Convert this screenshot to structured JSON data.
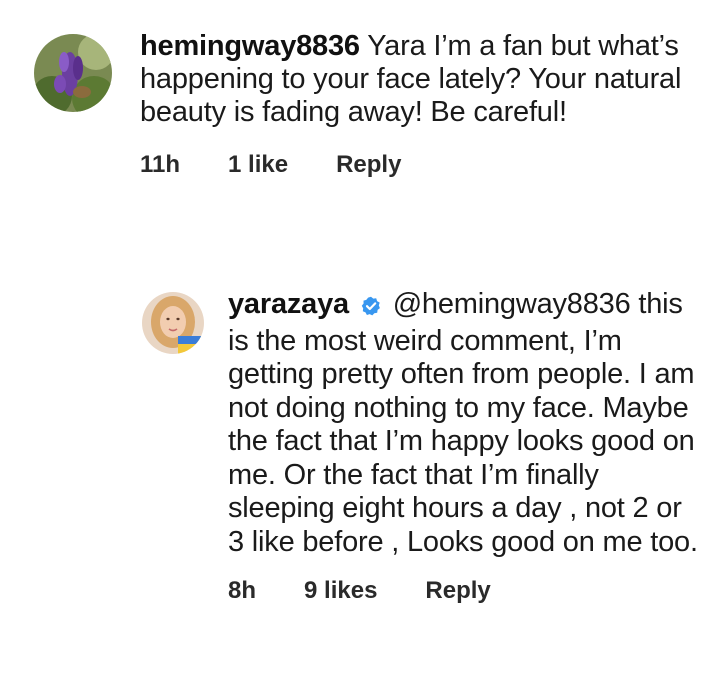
{
  "comments": [
    {
      "username": "hemingway8836",
      "text": "Yara I’m a fan but what’s happening to your face lately? Your natural beauty is fading away! Be careful!",
      "time": "11h",
      "likes": "1 like",
      "reply_label": "Reply",
      "avatar_icon": "profile-photo-purple-flowers"
    },
    {
      "username": "yarazaya",
      "verified": true,
      "mention": "@hemingway8836",
      "text": "this is the most weird comment, I’m getting pretty often from people. I am not doing nothing to my face. Maybe the fact that I’m happy looks good on me. Or the fact that I’m  finally sleeping eight hours a day , not 2 or 3 like before , Looks good on me too.",
      "time": "8h",
      "likes": "9 likes",
      "reply_label": "Reply",
      "avatar_icon": "profile-photo-woman"
    }
  ],
  "colors": {
    "verified_badge": "#3897f0",
    "text": "#1a1a1a"
  }
}
